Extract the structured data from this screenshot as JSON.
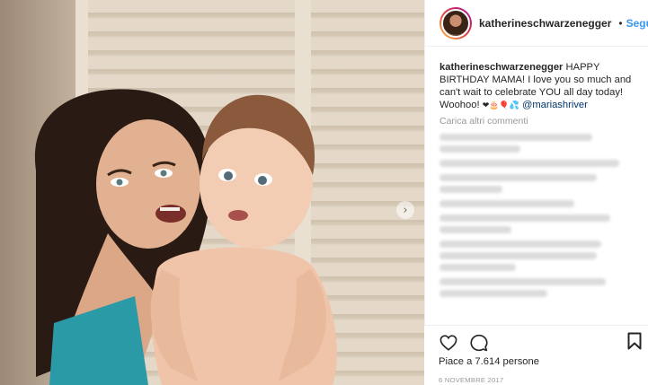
{
  "post": {
    "username": "katherineschwarzenegger",
    "follow_label": "Segui",
    "separator": "•"
  },
  "caption": {
    "author": "katherineschwarzenegger",
    "text": " HAPPY BIRTHDAY MAMA! I love you so much and can't wait to celebrate YOU all day today! Woohoo! ",
    "emojis": "❤🎂🎈💦",
    "mention": "@mariashriver"
  },
  "comments": {
    "load_more_label": "Carica altri commenti",
    "blurred_count": 8
  },
  "actions": {
    "likes_label": "Piace a 7.614 persone",
    "date": "6 NOVEMBRE 2017"
  },
  "icons": {
    "verified": "verified-badge-icon",
    "like": "heart-icon",
    "comment": "comment-icon",
    "save": "bookmark-icon",
    "next": "chevron-right-icon"
  },
  "colors": {
    "link": "#3897f0",
    "mention": "#003569",
    "meta": "#999999",
    "text": "#262626"
  }
}
